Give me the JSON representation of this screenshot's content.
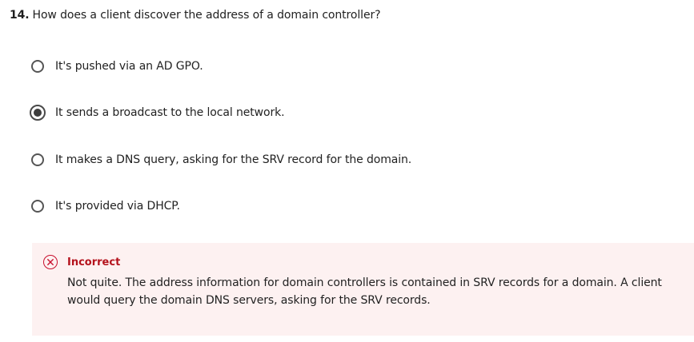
{
  "question": {
    "number": "14.",
    "text": "How does a client discover the address of a domain controller?"
  },
  "options": [
    {
      "label": "It's pushed via an AD GPO.",
      "selected": false
    },
    {
      "label": "It sends a broadcast to the local network.",
      "selected": true
    },
    {
      "label": "It makes a DNS query, asking for the SRV record for the domain.",
      "selected": false
    },
    {
      "label": "It's provided via DHCP.",
      "selected": false
    }
  ],
  "feedback": {
    "status": "Incorrect",
    "icon": "close-circle-icon",
    "message": "Not quite. The address information for domain controllers is contained in SRV records for a domain. A client would query the domain DNS servers, asking for the SRV records.",
    "colors": {
      "background": "#fdf1f1",
      "accent": "#c8102e"
    }
  }
}
